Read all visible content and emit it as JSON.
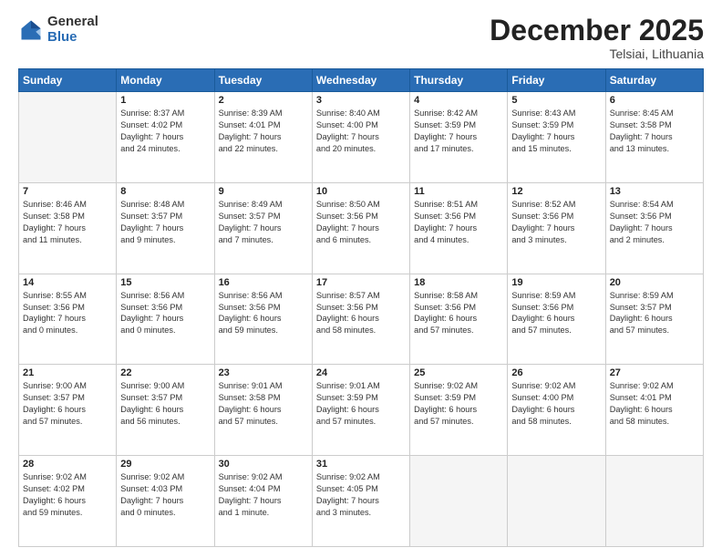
{
  "logo": {
    "general": "General",
    "blue": "Blue"
  },
  "title": "December 2025",
  "subtitle": "Telsiai, Lithuania",
  "weekdays": [
    "Sunday",
    "Monday",
    "Tuesday",
    "Wednesday",
    "Thursday",
    "Friday",
    "Saturday"
  ],
  "weeks": [
    [
      {
        "day": "",
        "info": ""
      },
      {
        "day": "1",
        "info": "Sunrise: 8:37 AM\nSunset: 4:02 PM\nDaylight: 7 hours\nand 24 minutes."
      },
      {
        "day": "2",
        "info": "Sunrise: 8:39 AM\nSunset: 4:01 PM\nDaylight: 7 hours\nand 22 minutes."
      },
      {
        "day": "3",
        "info": "Sunrise: 8:40 AM\nSunset: 4:00 PM\nDaylight: 7 hours\nand 20 minutes."
      },
      {
        "day": "4",
        "info": "Sunrise: 8:42 AM\nSunset: 3:59 PM\nDaylight: 7 hours\nand 17 minutes."
      },
      {
        "day": "5",
        "info": "Sunrise: 8:43 AM\nSunset: 3:59 PM\nDaylight: 7 hours\nand 15 minutes."
      },
      {
        "day": "6",
        "info": "Sunrise: 8:45 AM\nSunset: 3:58 PM\nDaylight: 7 hours\nand 13 minutes."
      }
    ],
    [
      {
        "day": "7",
        "info": "Sunrise: 8:46 AM\nSunset: 3:58 PM\nDaylight: 7 hours\nand 11 minutes."
      },
      {
        "day": "8",
        "info": "Sunrise: 8:48 AM\nSunset: 3:57 PM\nDaylight: 7 hours\nand 9 minutes."
      },
      {
        "day": "9",
        "info": "Sunrise: 8:49 AM\nSunset: 3:57 PM\nDaylight: 7 hours\nand 7 minutes."
      },
      {
        "day": "10",
        "info": "Sunrise: 8:50 AM\nSunset: 3:56 PM\nDaylight: 7 hours\nand 6 minutes."
      },
      {
        "day": "11",
        "info": "Sunrise: 8:51 AM\nSunset: 3:56 PM\nDaylight: 7 hours\nand 4 minutes."
      },
      {
        "day": "12",
        "info": "Sunrise: 8:52 AM\nSunset: 3:56 PM\nDaylight: 7 hours\nand 3 minutes."
      },
      {
        "day": "13",
        "info": "Sunrise: 8:54 AM\nSunset: 3:56 PM\nDaylight: 7 hours\nand 2 minutes."
      }
    ],
    [
      {
        "day": "14",
        "info": "Sunrise: 8:55 AM\nSunset: 3:56 PM\nDaylight: 7 hours\nand 0 minutes."
      },
      {
        "day": "15",
        "info": "Sunrise: 8:56 AM\nSunset: 3:56 PM\nDaylight: 7 hours\nand 0 minutes."
      },
      {
        "day": "16",
        "info": "Sunrise: 8:56 AM\nSunset: 3:56 PM\nDaylight: 6 hours\nand 59 minutes."
      },
      {
        "day": "17",
        "info": "Sunrise: 8:57 AM\nSunset: 3:56 PM\nDaylight: 6 hours\nand 58 minutes."
      },
      {
        "day": "18",
        "info": "Sunrise: 8:58 AM\nSunset: 3:56 PM\nDaylight: 6 hours\nand 57 minutes."
      },
      {
        "day": "19",
        "info": "Sunrise: 8:59 AM\nSunset: 3:56 PM\nDaylight: 6 hours\nand 57 minutes."
      },
      {
        "day": "20",
        "info": "Sunrise: 8:59 AM\nSunset: 3:57 PM\nDaylight: 6 hours\nand 57 minutes."
      }
    ],
    [
      {
        "day": "21",
        "info": "Sunrise: 9:00 AM\nSunset: 3:57 PM\nDaylight: 6 hours\nand 57 minutes."
      },
      {
        "day": "22",
        "info": "Sunrise: 9:00 AM\nSunset: 3:57 PM\nDaylight: 6 hours\nand 56 minutes."
      },
      {
        "day": "23",
        "info": "Sunrise: 9:01 AM\nSunset: 3:58 PM\nDaylight: 6 hours\nand 57 minutes."
      },
      {
        "day": "24",
        "info": "Sunrise: 9:01 AM\nSunset: 3:59 PM\nDaylight: 6 hours\nand 57 minutes."
      },
      {
        "day": "25",
        "info": "Sunrise: 9:02 AM\nSunset: 3:59 PM\nDaylight: 6 hours\nand 57 minutes."
      },
      {
        "day": "26",
        "info": "Sunrise: 9:02 AM\nSunset: 4:00 PM\nDaylight: 6 hours\nand 58 minutes."
      },
      {
        "day": "27",
        "info": "Sunrise: 9:02 AM\nSunset: 4:01 PM\nDaylight: 6 hours\nand 58 minutes."
      }
    ],
    [
      {
        "day": "28",
        "info": "Sunrise: 9:02 AM\nSunset: 4:02 PM\nDaylight: 6 hours\nand 59 minutes."
      },
      {
        "day": "29",
        "info": "Sunrise: 9:02 AM\nSunset: 4:03 PM\nDaylight: 7 hours\nand 0 minutes."
      },
      {
        "day": "30",
        "info": "Sunrise: 9:02 AM\nSunset: 4:04 PM\nDaylight: 7 hours\nand 1 minute."
      },
      {
        "day": "31",
        "info": "Sunrise: 9:02 AM\nSunset: 4:05 PM\nDaylight: 7 hours\nand 3 minutes."
      },
      {
        "day": "",
        "info": ""
      },
      {
        "day": "",
        "info": ""
      },
      {
        "day": "",
        "info": ""
      }
    ]
  ]
}
